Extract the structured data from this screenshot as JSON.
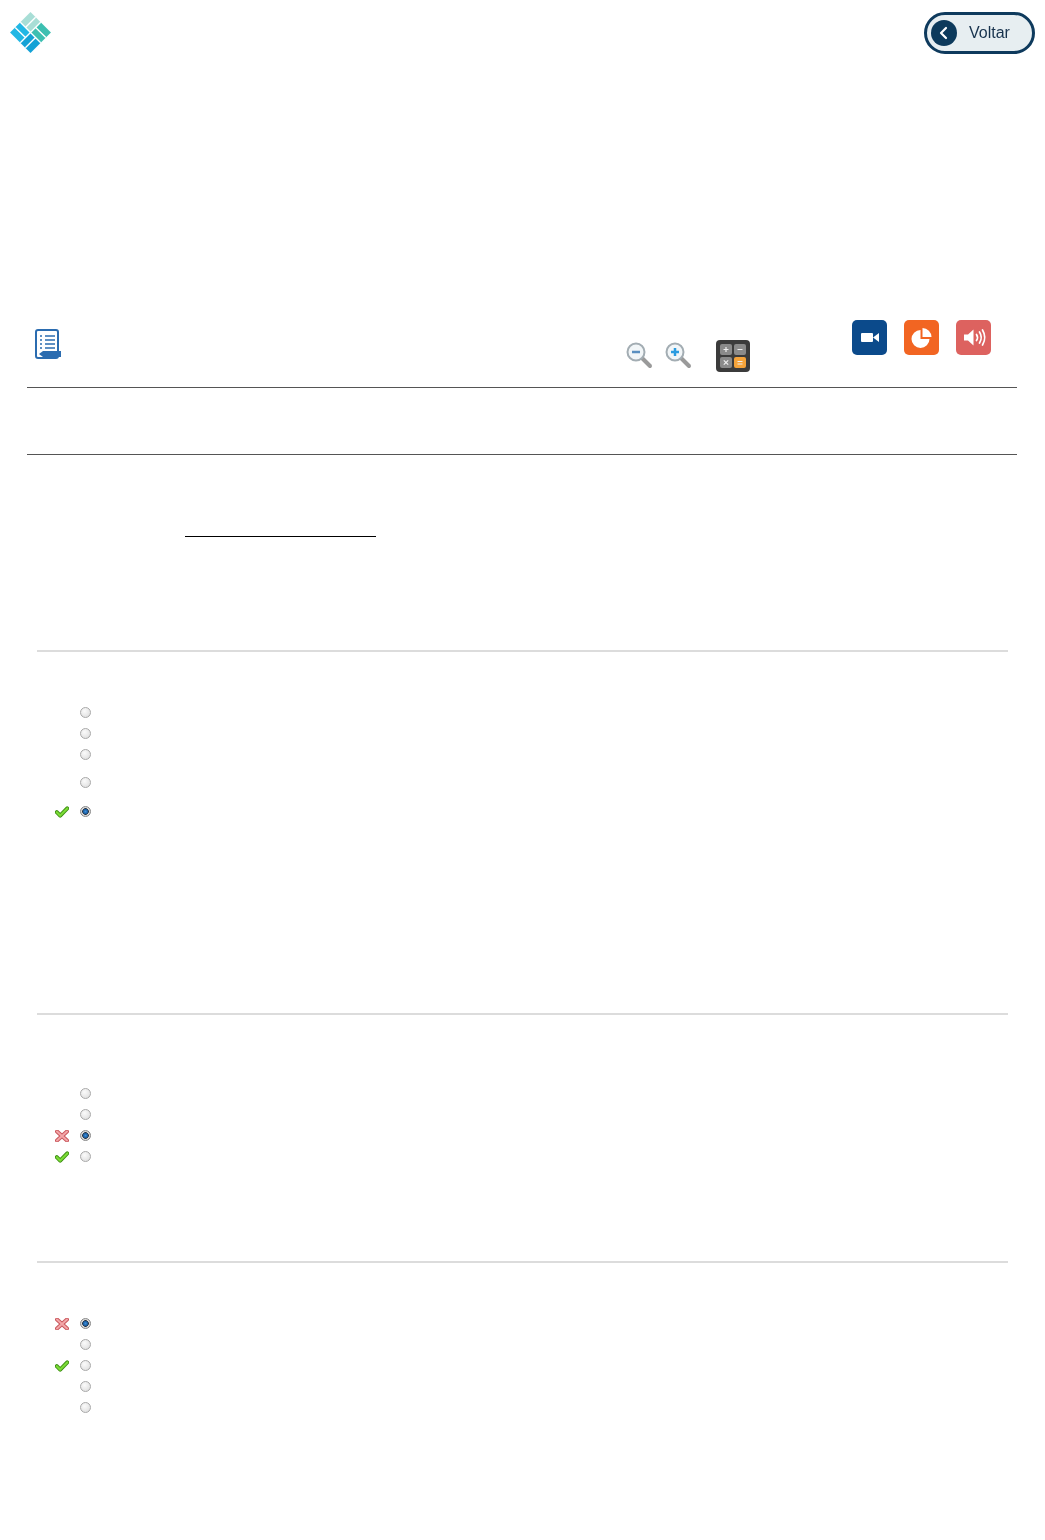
{
  "header": {
    "back_button": {
      "label": "Voltar"
    }
  },
  "questions": [
    {
      "options": [
        {
          "selected": false,
          "correct": false
        },
        {
          "selected": false,
          "correct": false
        },
        {
          "selected": false,
          "correct": false
        },
        {
          "selected": false,
          "correct": false
        },
        {
          "selected": true,
          "correct": true
        }
      ]
    },
    {
      "options": [
        {
          "selected": false,
          "correct": false
        },
        {
          "selected": false,
          "correct": false
        },
        {
          "selected": true,
          "correct": false
        },
        {
          "selected": false,
          "correct": true
        }
      ]
    },
    {
      "options": [
        {
          "selected": true,
          "correct": false
        },
        {
          "selected": false,
          "correct": false
        },
        {
          "selected": false,
          "correct": true
        },
        {
          "selected": false,
          "correct": false
        },
        {
          "selected": false,
          "correct": false
        }
      ]
    }
  ]
}
